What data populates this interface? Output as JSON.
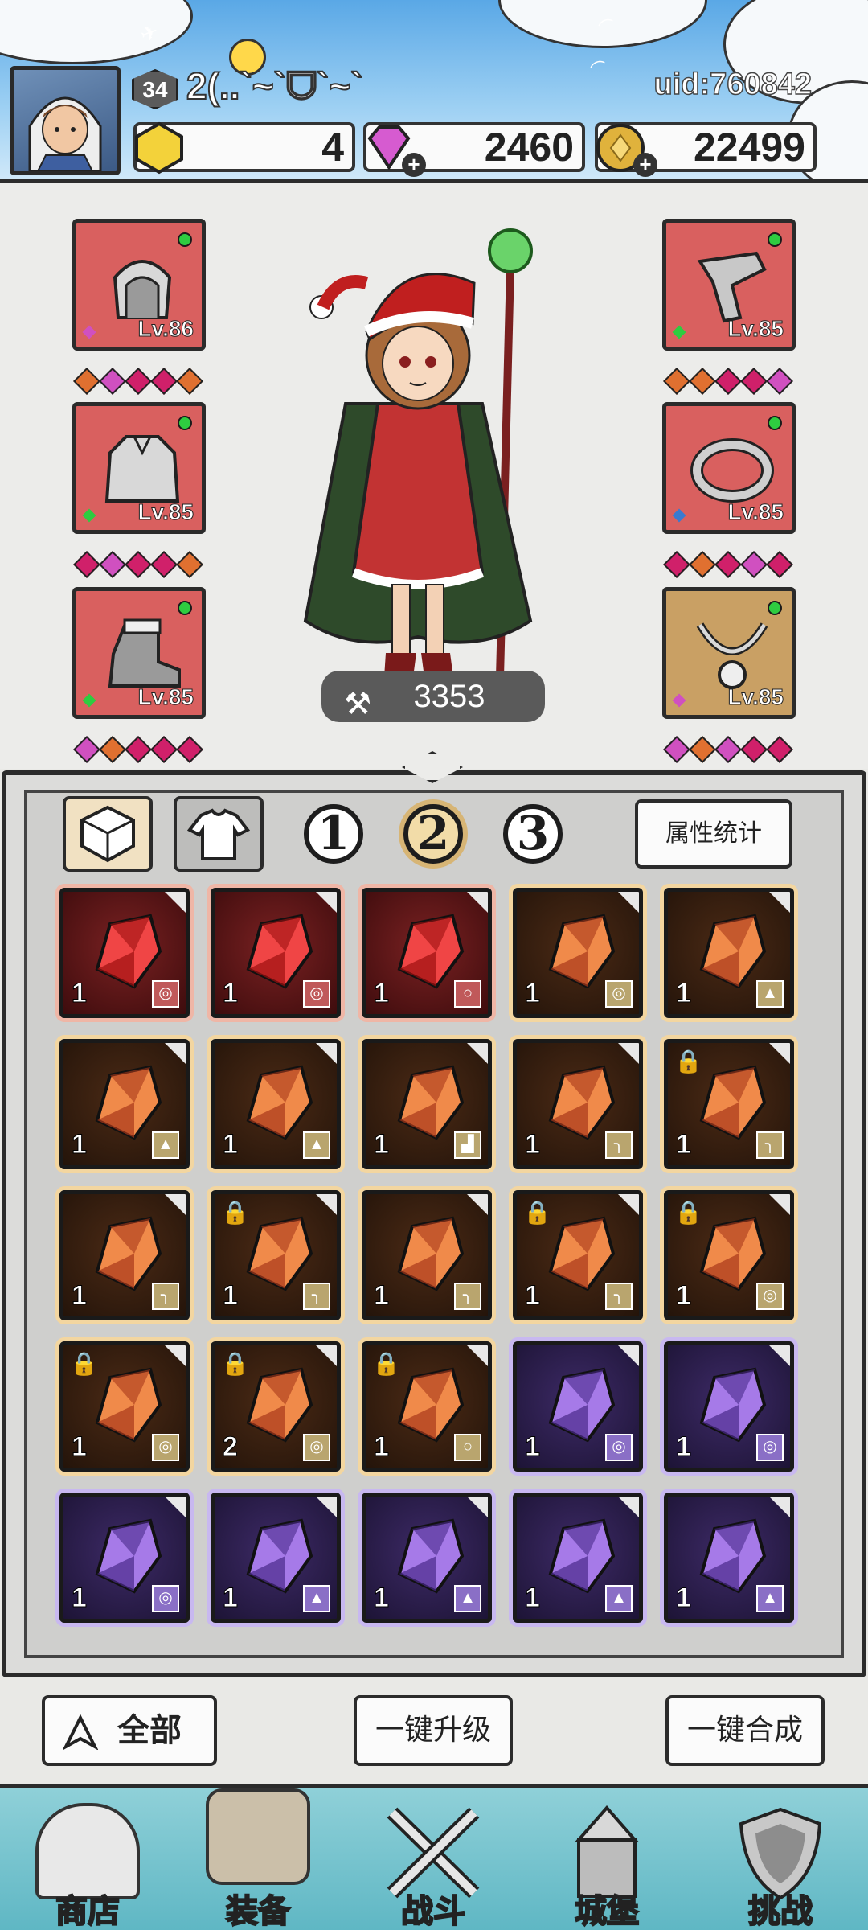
{
  "header": {
    "player_name": "2(..`~`ᗜ`~`",
    "level": "34",
    "uid": "uid:760842",
    "resources": [
      {
        "name": "gold-gem",
        "value": "4",
        "color": "#f3d23a"
      },
      {
        "name": "diamond",
        "value": "2460",
        "color": "#d65bd0"
      },
      {
        "name": "coin",
        "value": "22499",
        "color": "#e0b23c"
      }
    ]
  },
  "equipment": {
    "left": [
      {
        "slot": "helmet",
        "level": "Lv.86",
        "gems": [
          "#e07030",
          "#d050c0",
          "#d0206a",
          "#d0206a",
          "#e07030"
        ]
      },
      {
        "slot": "armor",
        "level": "Lv.85",
        "gems": [
          "#d0206a",
          "#d050c0",
          "#d0206a",
          "#d0206a",
          "#e07030"
        ]
      },
      {
        "slot": "boots",
        "level": "Lv.85",
        "gems": [
          "#d050c0",
          "#e07030",
          "#d0206a",
          "#d0206a",
          "#d0206a"
        ]
      }
    ],
    "right": [
      {
        "slot": "bracer",
        "level": "Lv.85",
        "gems": [
          "#e07030",
          "#e07030",
          "#d0206a",
          "#d0206a",
          "#d050c0"
        ]
      },
      {
        "slot": "ring",
        "level": "Lv.85",
        "gems": [
          "#d0206a",
          "#e07030",
          "#d0206a",
          "#d050c0",
          "#d0206a"
        ]
      },
      {
        "slot": "necklace",
        "level": "Lv.85",
        "gems": [
          "#d050c0",
          "#e07030",
          "#d050c0",
          "#d0206a",
          "#d0206a"
        ]
      }
    ],
    "power": "3353"
  },
  "tabs": {
    "pages": [
      "1",
      "2",
      "3"
    ],
    "active_page": "2",
    "stats_button": "属性统计"
  },
  "inventory": [
    {
      "rarity": "red",
      "qty": "1",
      "slot": "◎",
      "locked": false
    },
    {
      "rarity": "red",
      "qty": "1",
      "slot": "◎",
      "locked": false
    },
    {
      "rarity": "red",
      "qty": "1",
      "slot": "○",
      "locked": false
    },
    {
      "rarity": "orange",
      "qty": "1",
      "slot": "◎",
      "locked": false
    },
    {
      "rarity": "orange",
      "qty": "1",
      "slot": "▲",
      "locked": false
    },
    {
      "rarity": "orange",
      "qty": "1",
      "slot": "▲",
      "locked": false
    },
    {
      "rarity": "orange",
      "qty": "1",
      "slot": "▲",
      "locked": false
    },
    {
      "rarity": "orange",
      "qty": "1",
      "slot": "▟",
      "locked": false
    },
    {
      "rarity": "orange",
      "qty": "1",
      "slot": "╮",
      "locked": false
    },
    {
      "rarity": "orange",
      "qty": "1",
      "slot": "╮",
      "locked": true
    },
    {
      "rarity": "orange",
      "qty": "1",
      "slot": "╮",
      "locked": false
    },
    {
      "rarity": "orange",
      "qty": "1",
      "slot": "╮",
      "locked": true
    },
    {
      "rarity": "orange",
      "qty": "1",
      "slot": "╮",
      "locked": false
    },
    {
      "rarity": "orange",
      "qty": "1",
      "slot": "╮",
      "locked": true
    },
    {
      "rarity": "orange",
      "qty": "1",
      "slot": "◎",
      "locked": true
    },
    {
      "rarity": "orange",
      "qty": "1",
      "slot": "◎",
      "locked": true
    },
    {
      "rarity": "orange",
      "qty": "2",
      "slot": "◎",
      "locked": true
    },
    {
      "rarity": "orange",
      "qty": "1",
      "slot": "○",
      "locked": true
    },
    {
      "rarity": "purple",
      "qty": "1",
      "slot": "◎",
      "locked": false
    },
    {
      "rarity": "purple",
      "qty": "1",
      "slot": "◎",
      "locked": false
    },
    {
      "rarity": "purple",
      "qty": "1",
      "slot": "◎",
      "locked": false
    },
    {
      "rarity": "purple",
      "qty": "1",
      "slot": "▲",
      "locked": false
    },
    {
      "rarity": "purple",
      "qty": "1",
      "slot": "▲",
      "locked": false
    },
    {
      "rarity": "purple",
      "qty": "1",
      "slot": "▲",
      "locked": false
    },
    {
      "rarity": "purple",
      "qty": "1",
      "slot": "▲",
      "locked": false
    }
  ],
  "actions": {
    "filter_label": "全部",
    "upgrade_label": "一键升级",
    "merge_label": "一键合成"
  },
  "nav": [
    {
      "id": "shop",
      "label": "商店"
    },
    {
      "id": "equipment",
      "label": "装备"
    },
    {
      "id": "battle",
      "label": "战斗"
    },
    {
      "id": "castle",
      "label": "城堡"
    },
    {
      "id": "challenge",
      "label": "挑战"
    }
  ]
}
